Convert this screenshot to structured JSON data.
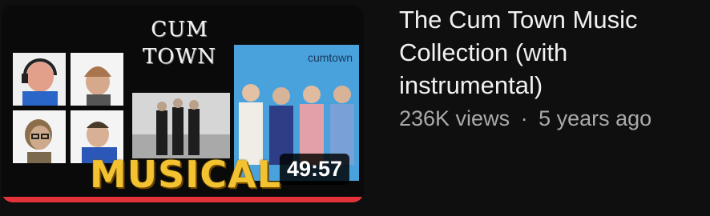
{
  "video": {
    "title": "The Cum Town Music Collection (with instrumental)",
    "duration": "49:57",
    "views": "236K views",
    "separator": "·",
    "age": "5 years ago",
    "watch_progress_percent": 100
  },
  "thumbnail": {
    "logo_line1": "CUM",
    "logo_line2": "TOWN",
    "album_label": "cumtown",
    "banner_text": "MUSICAL"
  },
  "colors": {
    "background": "#0f0f0f",
    "title": "#f1f1f1",
    "meta": "#aaaaaa",
    "progress": "#e3323a",
    "banner": "#f2c230",
    "album_blue": "#4aa2dd"
  }
}
